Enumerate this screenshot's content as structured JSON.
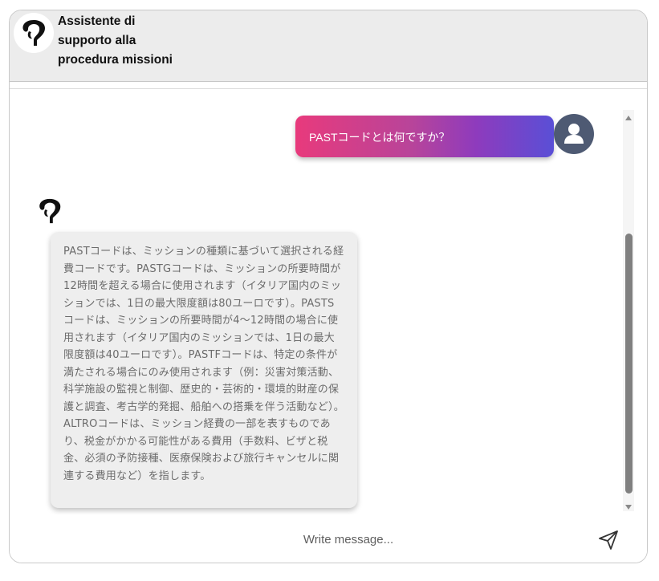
{
  "header": {
    "title": "Assistente di supporto alla procedura missioni",
    "logo_icon": "stylized-figure-logo-icon"
  },
  "chat": {
    "messages": [
      {
        "role": "user",
        "text": "PASTコードとは何ですか？",
        "avatar_icon": "user-avatar-icon",
        "gradient": [
          "#e83a7c",
          "#8e3bbd",
          "#5a4fd6"
        ]
      },
      {
        "role": "assistant",
        "avatar_icon": "bot-logo-icon",
        "text": "PASTコードは、ミッションの種類に基づいて選択される経費コードです。PASTGコードは、ミッションの所要時間が12時間を超える場合に使用されます（イタリア国内のミッションでは、1日の最大限度額は80ユーロです）。PASTSコードは、ミッションの所要時間が4〜12時間の場合に使用されます（イタリア国内のミッションでは、1日の最大限度額は40ユーロです）。PASTFコードは、特定の条件が満たされる場合にのみ使用されます（例：災害対策活動、科学施設の監視と制御、歴史的・芸術的・環境的財産の保護と調査、考古学的発掘、船舶への搭乗を伴う活動など）。ALTROコードは、ミッション経費の一部を表すものであり、税金がかかる可能性がある費用（手数料、ビザと税金、必須の予防接種、医療保険および旅行キャンセルに関連する費用など）を指します。"
      }
    ]
  },
  "composer": {
    "placeholder": "Write message...",
    "send_icon": "send-icon"
  },
  "colors": {
    "header_bg": "#ececec",
    "bot_bubble_bg": "#eeeeee",
    "user_avatar_bg": "#4e5a73"
  }
}
